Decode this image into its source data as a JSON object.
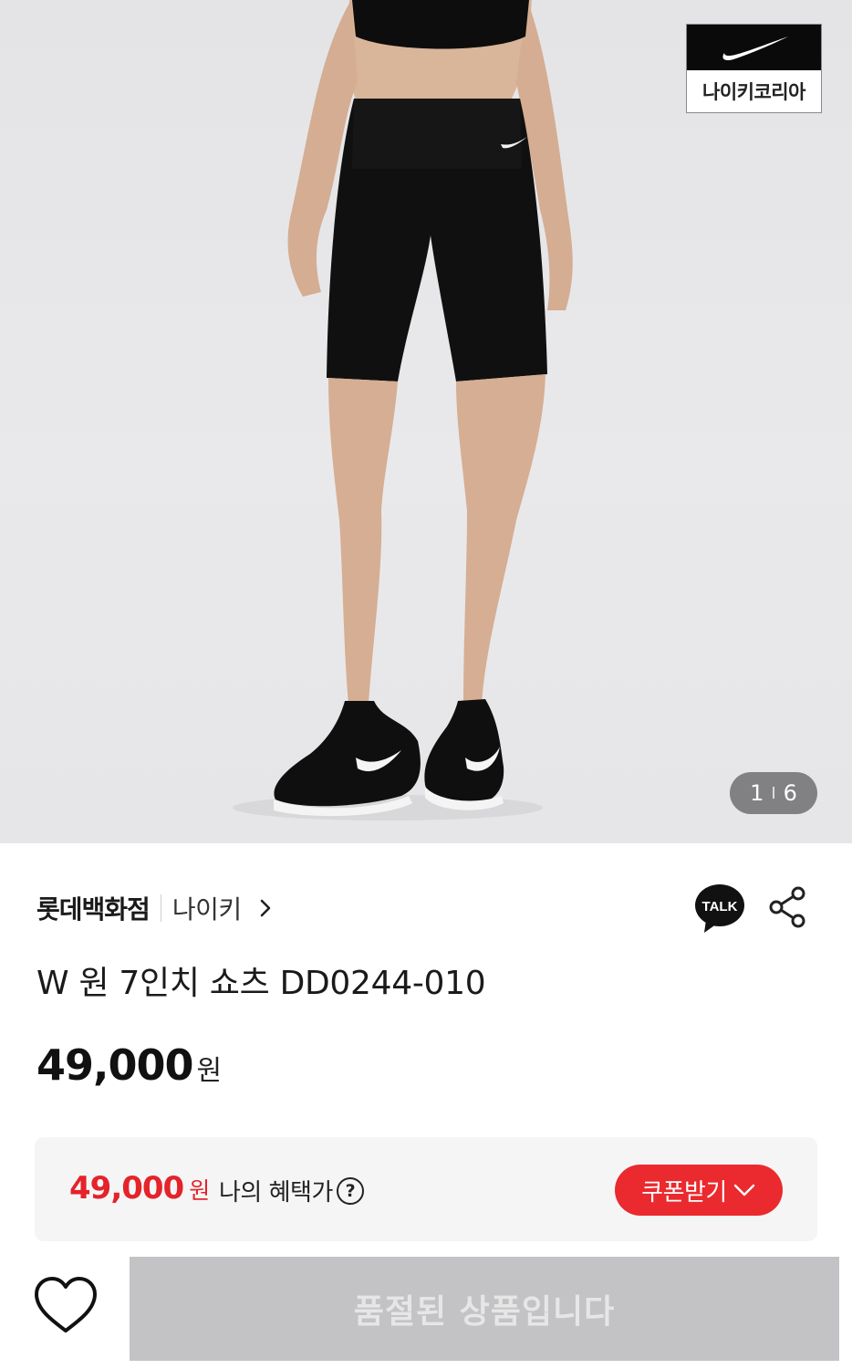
{
  "gallery": {
    "brand_logo_text": "나이키코리아",
    "current_index": "1",
    "separator": "I",
    "total": "6"
  },
  "shop": {
    "store_name": "롯데백화점",
    "brand_name": "나이키"
  },
  "actions": {
    "talk_label": "TALK"
  },
  "product": {
    "title": "W 원 7인치 쇼츠 DD0244-010",
    "price": "49,000",
    "price_unit": "원"
  },
  "benefit": {
    "price": "49,000",
    "price_unit": "원",
    "label": "나의 혜택가",
    "help": "?",
    "coupon_button": "쿠폰받기"
  },
  "bottom_bar": {
    "status_button": "품절된 상품입니다"
  },
  "colors": {
    "accent_red": "#e4232a",
    "soldout_gray": "#c3c3c5"
  }
}
